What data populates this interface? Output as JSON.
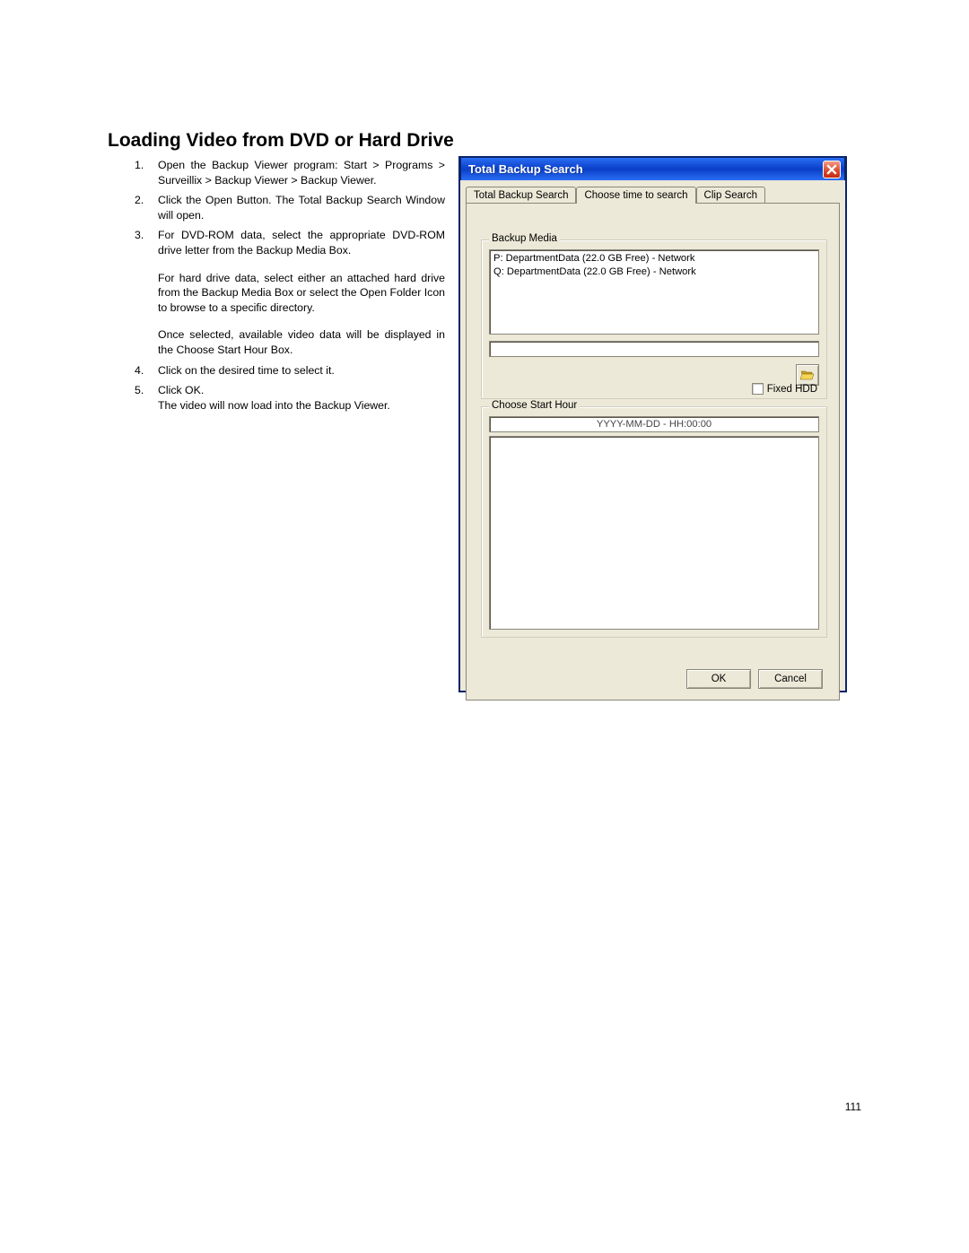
{
  "heading": "Loading Video from DVD or Hard Drive",
  "steps": [
    {
      "n": "1",
      "text_a": "Open the Backup Viewer program: Start > Programs > Surveillix > Backup Viewer > Backup Viewer.",
      "justify": true
    },
    {
      "n": "2",
      "text_a": "Click the Open Button. The Total Backup Search Window will open.",
      "justify": true
    },
    {
      "n": "3",
      "text_a": "For DVD-ROM data, select the appropriate DVD-ROM drive letter from the Backup Media Box.",
      "text_b": "For hard drive data, select either an attached hard drive from the Backup Media Box or select the Open Folder Icon to browse to a specific directory.",
      "text_c": "Once selected, available video data will be displayed in the Choose Start Hour Box.",
      "justify": true
    },
    {
      "n": "4",
      "text_a": "Click on the desired time to select it."
    },
    {
      "n": "5",
      "text_a": "Click OK.",
      "text_b": "The video will now load into the Backup Viewer."
    }
  ],
  "dialog": {
    "title": "Total Backup Search",
    "tabs": [
      "Total Backup Search",
      "Choose time to search",
      "Clip Search"
    ],
    "active_tab": 1,
    "backup_media_legend": "Backup Media",
    "media_items": [
      "P:   DepartmentData (22.0 GB Free) - Network",
      "Q:   DepartmentData (22.0 GB Free) - Network"
    ],
    "fixed_hdd_label": "Fixed HDD",
    "choose_hour_legend": "Choose Start Hour",
    "hour_placeholder": "YYYY-MM-DD - HH:00:00",
    "ok_label": "OK",
    "cancel_label": "Cancel"
  },
  "page_number": "111"
}
